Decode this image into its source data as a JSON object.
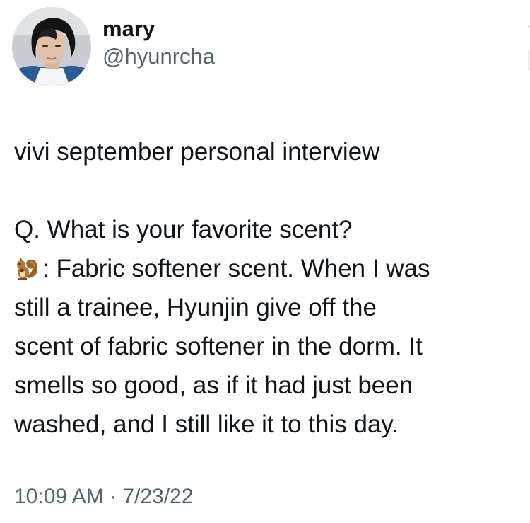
{
  "user": {
    "display_name": "mary",
    "handle": "@hyunrcha",
    "avatar_icon": "profile-photo"
  },
  "tweet": {
    "title_line": "vivi september personal interview",
    "question": "Q. What is your favorite scent?",
    "answer_emoji": "squirrel-icon",
    "answer_lines": [
      ": Fabric softener scent. When I was",
      "still a trainee, Hyunjin give off the",
      "scent of fabric softener in the dorm. It",
      "smells so good, as if it had just been",
      "washed, and I still like it to this day."
    ]
  },
  "meta": {
    "time": "10:09 AM",
    "separator": " · ",
    "date": "7/23/22"
  },
  "colors": {
    "text": "#0f1419",
    "secondary": "#536471",
    "background": "#ffffff"
  }
}
